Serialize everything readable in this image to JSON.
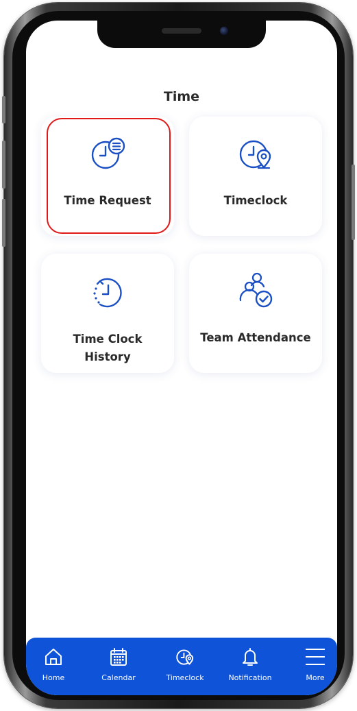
{
  "screen": {
    "title": "Time"
  },
  "tiles": [
    {
      "label": "Time Request",
      "icon": "clock-list-icon"
    },
    {
      "label": "Timeclock",
      "icon": "clock-location-icon"
    },
    {
      "label_line1": "Time Clock",
      "label_line2": "History",
      "icon": "clock-history-icon"
    },
    {
      "label": "Team Attendance",
      "icon": "team-check-icon"
    }
  ],
  "tabbar": [
    {
      "label": "Home",
      "icon": "home-icon"
    },
    {
      "label": "Calendar",
      "icon": "calendar-icon"
    },
    {
      "label": "Timeclock",
      "icon": "clock-location-icon"
    },
    {
      "label": "Notification",
      "icon": "bell-icon"
    },
    {
      "label": "More",
      "icon": "menu-icon"
    }
  ],
  "colors": {
    "accent": "#0e53d8",
    "icon": "#1a4fc4",
    "highlight": "#e01818",
    "text": "#2a2a2a"
  }
}
